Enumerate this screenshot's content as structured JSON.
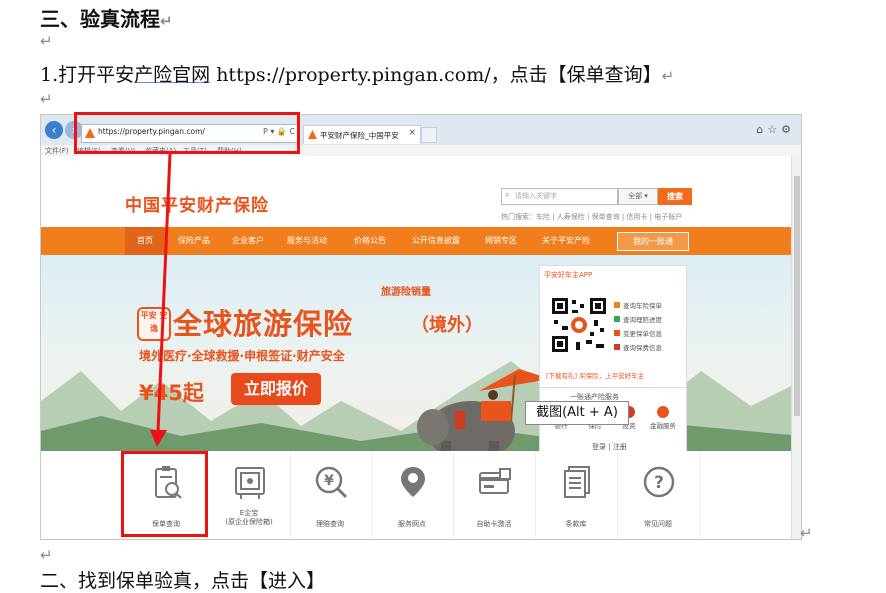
{
  "doc": {
    "heading": "三、验真流程",
    "return_mark": "↵",
    "step1_pre": "1.打开平安",
    "step1_link": "产险官网",
    "step1_url": " https://property.pingan.com/",
    "step1_post": "，点击【保单查询】",
    "bottom_partial": "二、找到保单验真，点击【进入】"
  },
  "screenshot": {
    "browser": {
      "url": "https://property.pingan.com/",
      "url_tools": "P ▾ 🔒 C",
      "tab_title": "平安财产保险_中国平安",
      "tab_close": "×",
      "window_icons": "⌂☆⚙",
      "menu": [
        "文件(F)",
        "编辑(E)",
        "查看(V)",
        "收藏夹(A)",
        "工具(T)",
        "帮助(H)"
      ]
    },
    "site": {
      "logo": "中国平安财产保险",
      "search_placeholder": "请输入关键字",
      "search_scope": "全部 ▾",
      "search_button": "搜索",
      "hot_search": "热门搜索：车险 | 人寿保险 | 保单查询 | 信用卡 | 电子账户",
      "nav": [
        "首页",
        "保险产品",
        "企业客户",
        "服务与活动",
        "价格公告",
        "公开信息披露",
        "网销专区",
        "关于平安产险"
      ],
      "my_account": "我的一账通",
      "banner": {
        "tag": "旅游险销量",
        "badge": "平安 安逸",
        "title": "全球旅游保险",
        "title_suffix": "（境外）",
        "subtitle": "境外医疗·全球救援·申根签证·财产安全",
        "price": "¥45起",
        "quote_button": "立即报价"
      },
      "app_panel": {
        "title": "平安好车主APP",
        "options": [
          "查询车险保单",
          "查询理赔进度",
          "变更保单信息",
          "查询保费信息"
        ],
        "download": "[下载有礼] 买保险，上平安好车主"
      },
      "service_panel": {
        "title": "一账通产险服务",
        "items": [
          "银行",
          "保险",
          "投资",
          "金融服务"
        ],
        "login": "登录 | 注册"
      },
      "tooltip": "截图(Alt + A)",
      "tiles": [
        "保单查询",
        "E企宝\n(原企业保险箱)",
        "理赔查询",
        "服务网点",
        "自助卡激活",
        "条款库",
        "常见问题"
      ]
    }
  }
}
